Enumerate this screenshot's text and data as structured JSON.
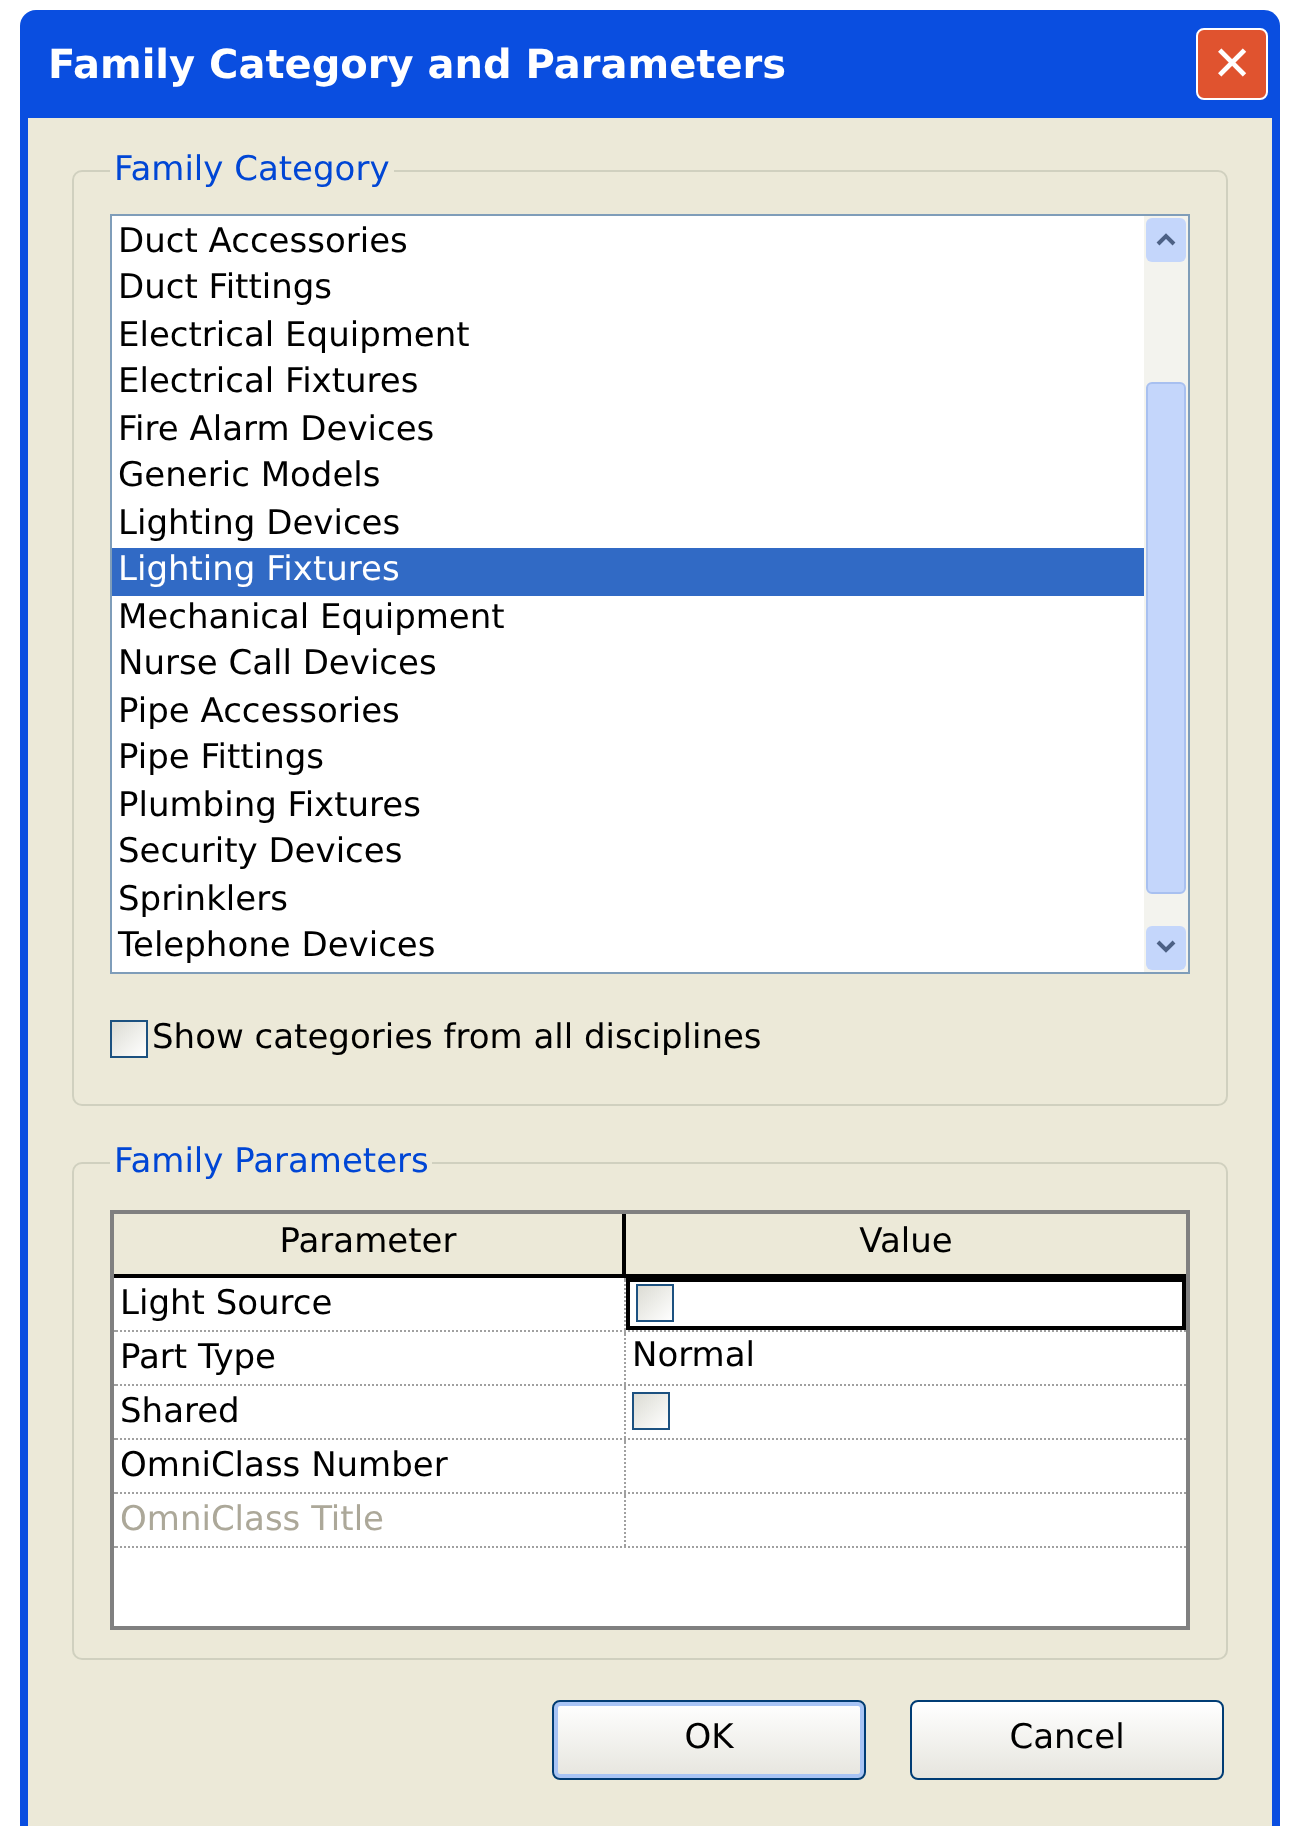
{
  "window": {
    "title": "Family Category and Parameters",
    "close_label": "✕"
  },
  "family_category": {
    "legend": "Family Category",
    "items": [
      {
        "label": "Duct Accessories",
        "selected": false
      },
      {
        "label": "Duct Fittings",
        "selected": false
      },
      {
        "label": "Electrical Equipment",
        "selected": false
      },
      {
        "label": "Electrical Fixtures",
        "selected": false
      },
      {
        "label": "Fire Alarm Devices",
        "selected": false
      },
      {
        "label": "Generic Models",
        "selected": false
      },
      {
        "label": "Lighting Devices",
        "selected": false
      },
      {
        "label": "Lighting Fixtures",
        "selected": true
      },
      {
        "label": "Mechanical Equipment",
        "selected": false
      },
      {
        "label": "Nurse Call Devices",
        "selected": false
      },
      {
        "label": "Pipe Accessories",
        "selected": false
      },
      {
        "label": "Pipe Fittings",
        "selected": false
      },
      {
        "label": "Plumbing Fixtures",
        "selected": false
      },
      {
        "label": "Security Devices",
        "selected": false
      },
      {
        "label": "Sprinklers",
        "selected": false
      },
      {
        "label": "Telephone Devices",
        "selected": false
      }
    ],
    "show_all": {
      "label": "Show categories from all disciplines",
      "checked": false
    }
  },
  "family_parameters": {
    "legend": "Family Parameters",
    "columns": [
      "Parameter",
      "Value"
    ],
    "rows": [
      {
        "name": "Light Source",
        "kind": "checkbox",
        "checked": false,
        "selected": true,
        "disabled": false
      },
      {
        "name": "Part Type",
        "kind": "text",
        "value": "Normal",
        "selected": false,
        "disabled": false
      },
      {
        "name": "Shared",
        "kind": "checkbox",
        "checked": false,
        "selected": false,
        "disabled": false
      },
      {
        "name": "OmniClass Number",
        "kind": "text",
        "selected": false,
        "disabled": false
      },
      {
        "name": "OmniClass Title",
        "kind": "text",
        "selected": false,
        "disabled": true
      }
    ]
  },
  "buttons": [
    {
      "label": "OK",
      "default": true
    },
    {
      "label": "Cancel",
      "default": false
    }
  ]
}
